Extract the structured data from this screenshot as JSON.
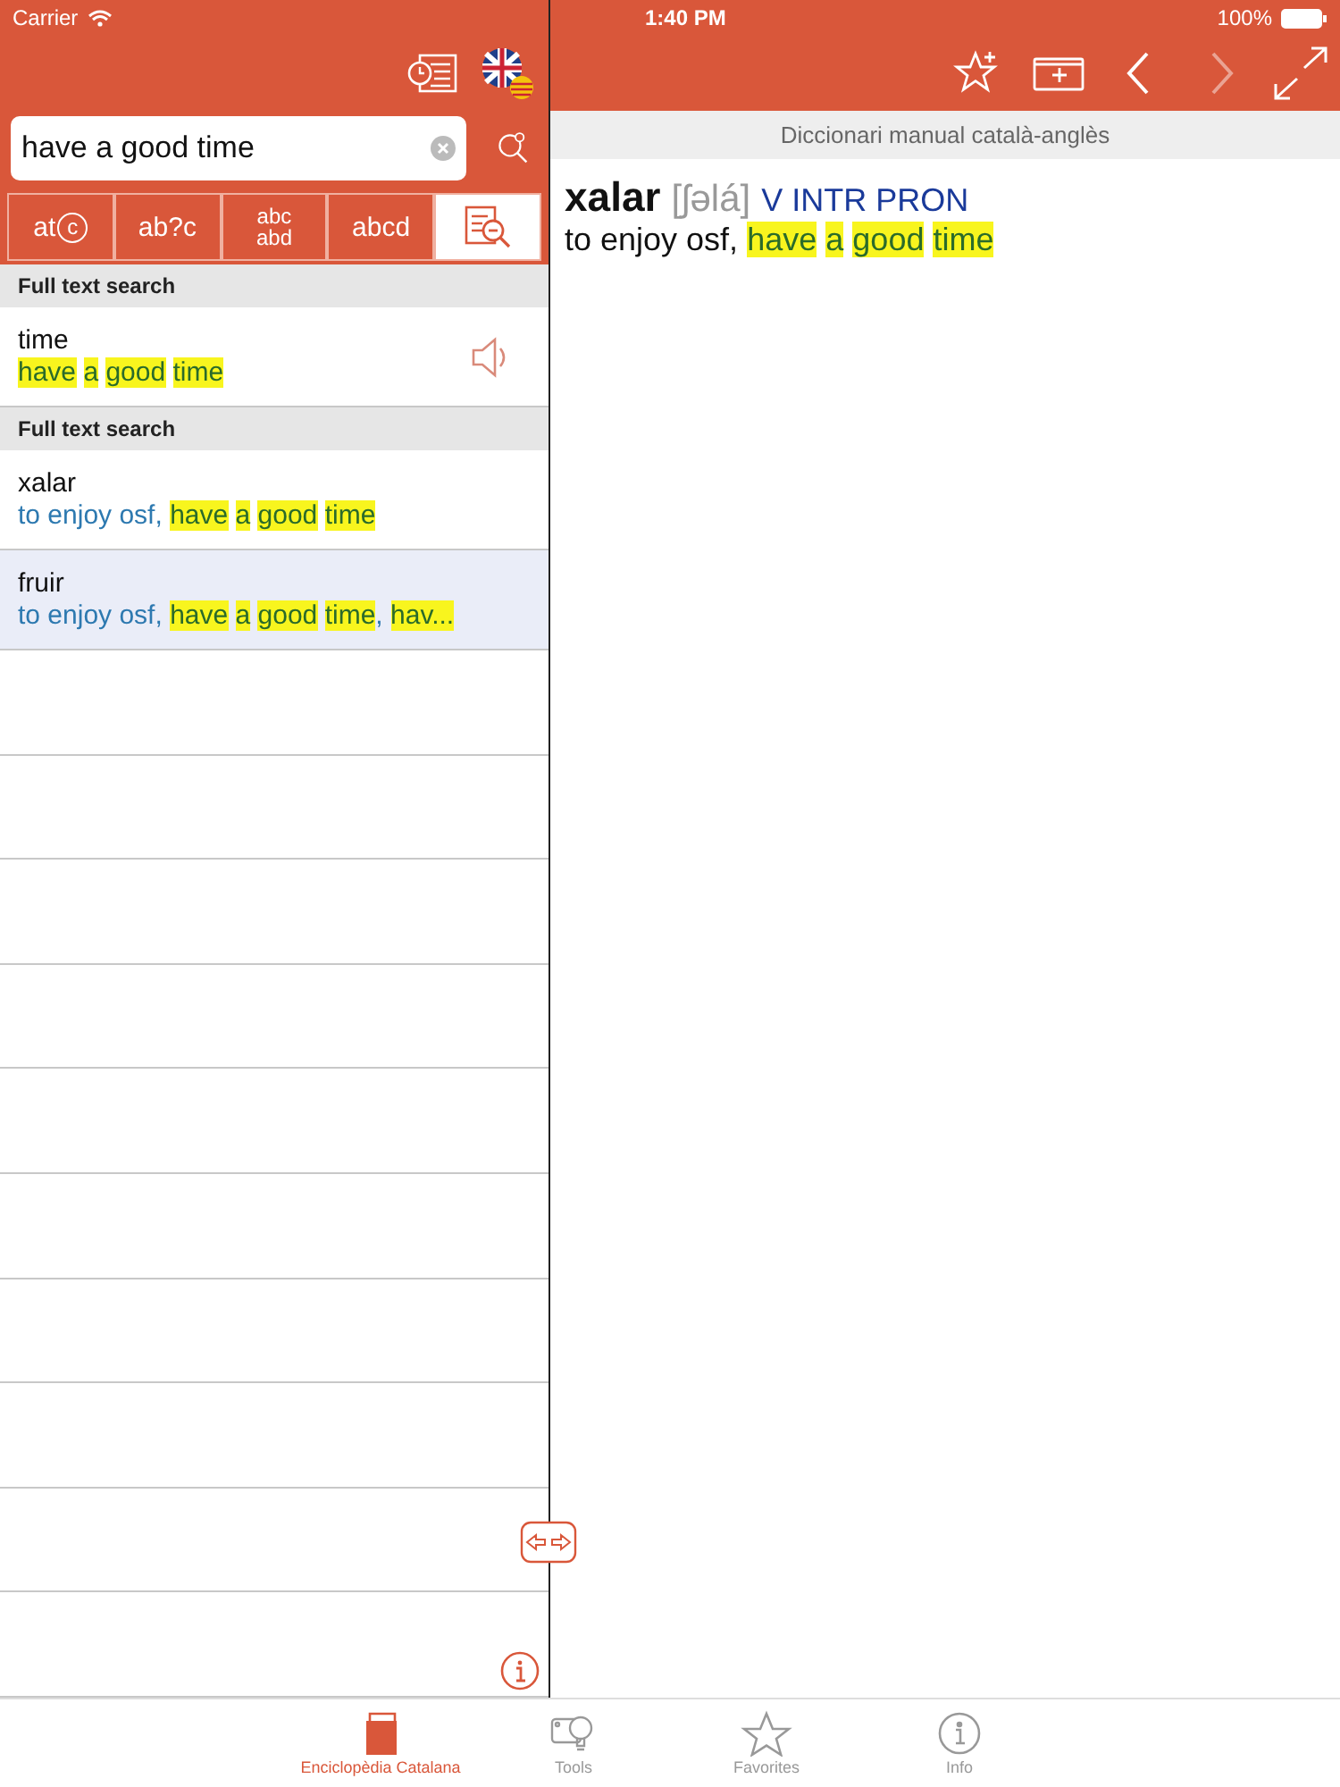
{
  "status_bar": {
    "carrier": "Carrier",
    "time": "1:40 PM",
    "battery": "100%"
  },
  "search": {
    "value": "have a good time"
  },
  "search_modes": [
    {
      "kind": "magnify-letter",
      "label": "at",
      "letter": "c",
      "selected": false
    },
    {
      "kind": "text",
      "label": "ab?c",
      "selected": false
    },
    {
      "kind": "fuzzy",
      "lines": [
        "abc",
        "abd"
      ],
      "selected": false
    },
    {
      "kind": "anagram",
      "label": "abcd",
      "selected": false
    },
    {
      "kind": "fulltext",
      "selected": true
    }
  ],
  "results": [
    {
      "section": "Full text search",
      "items": [
        {
          "headword": "time",
          "speaker": true,
          "selected": false,
          "snippet": [
            {
              "text": "have",
              "highlighted": true
            },
            {
              "text": "a",
              "highlighted": true
            },
            {
              "text": "good",
              "highlighted": true
            },
            {
              "text": "time",
              "highlighted": true
            }
          ]
        }
      ]
    },
    {
      "section": "Full text search",
      "items": [
        {
          "headword": "xalar",
          "speaker": false,
          "selected": false,
          "snippet": [
            {
              "text": "to enjoy osf,",
              "highlighted": false
            },
            {
              "text": "have",
              "highlighted": true
            },
            {
              "text": "a",
              "highlighted": true
            },
            {
              "text": "good",
              "highlighted": true
            },
            {
              "text": "time",
              "highlighted": true
            }
          ]
        },
        {
          "headword": "fruir",
          "speaker": false,
          "selected": true,
          "snippet": [
            {
              "text": "to enjoy osf,",
              "highlighted": false
            },
            {
              "text": "have",
              "highlighted": true
            },
            {
              "text": "a",
              "highlighted": true
            },
            {
              "text": "good",
              "highlighted": true
            },
            {
              "text": "time",
              "highlighted": true,
              "suffix": ","
            },
            {
              "text": "hav...",
              "highlighted": true
            }
          ]
        }
      ]
    }
  ],
  "right_toolbar": [
    {
      "kind": "favorite-add",
      "disabled": false
    },
    {
      "kind": "tab-add",
      "disabled": false
    },
    {
      "kind": "back",
      "disabled": false
    },
    {
      "kind": "forward",
      "disabled": true
    },
    {
      "kind": "fullscreen",
      "disabled": false
    }
  ],
  "entry": {
    "dictionary": "Diccionari manual català-anglès",
    "headword": "xalar",
    "pronunciation": "[ʃəlá]",
    "grammar": "V INTR PRON",
    "definition": [
      {
        "text": "to enjoy osf,",
        "highlighted": false
      },
      {
        "text": "have",
        "highlighted": true
      },
      {
        "text": "a",
        "highlighted": true
      },
      {
        "text": "good",
        "highlighted": true
      },
      {
        "text": "time",
        "highlighted": true
      }
    ]
  },
  "tab_bar": [
    {
      "label": "Enciclopèdia Catalana",
      "selected": true
    },
    {
      "label": "Tools",
      "selected": false
    },
    {
      "label": "Favorites",
      "selected": false
    },
    {
      "label": "Info",
      "selected": false
    }
  ]
}
